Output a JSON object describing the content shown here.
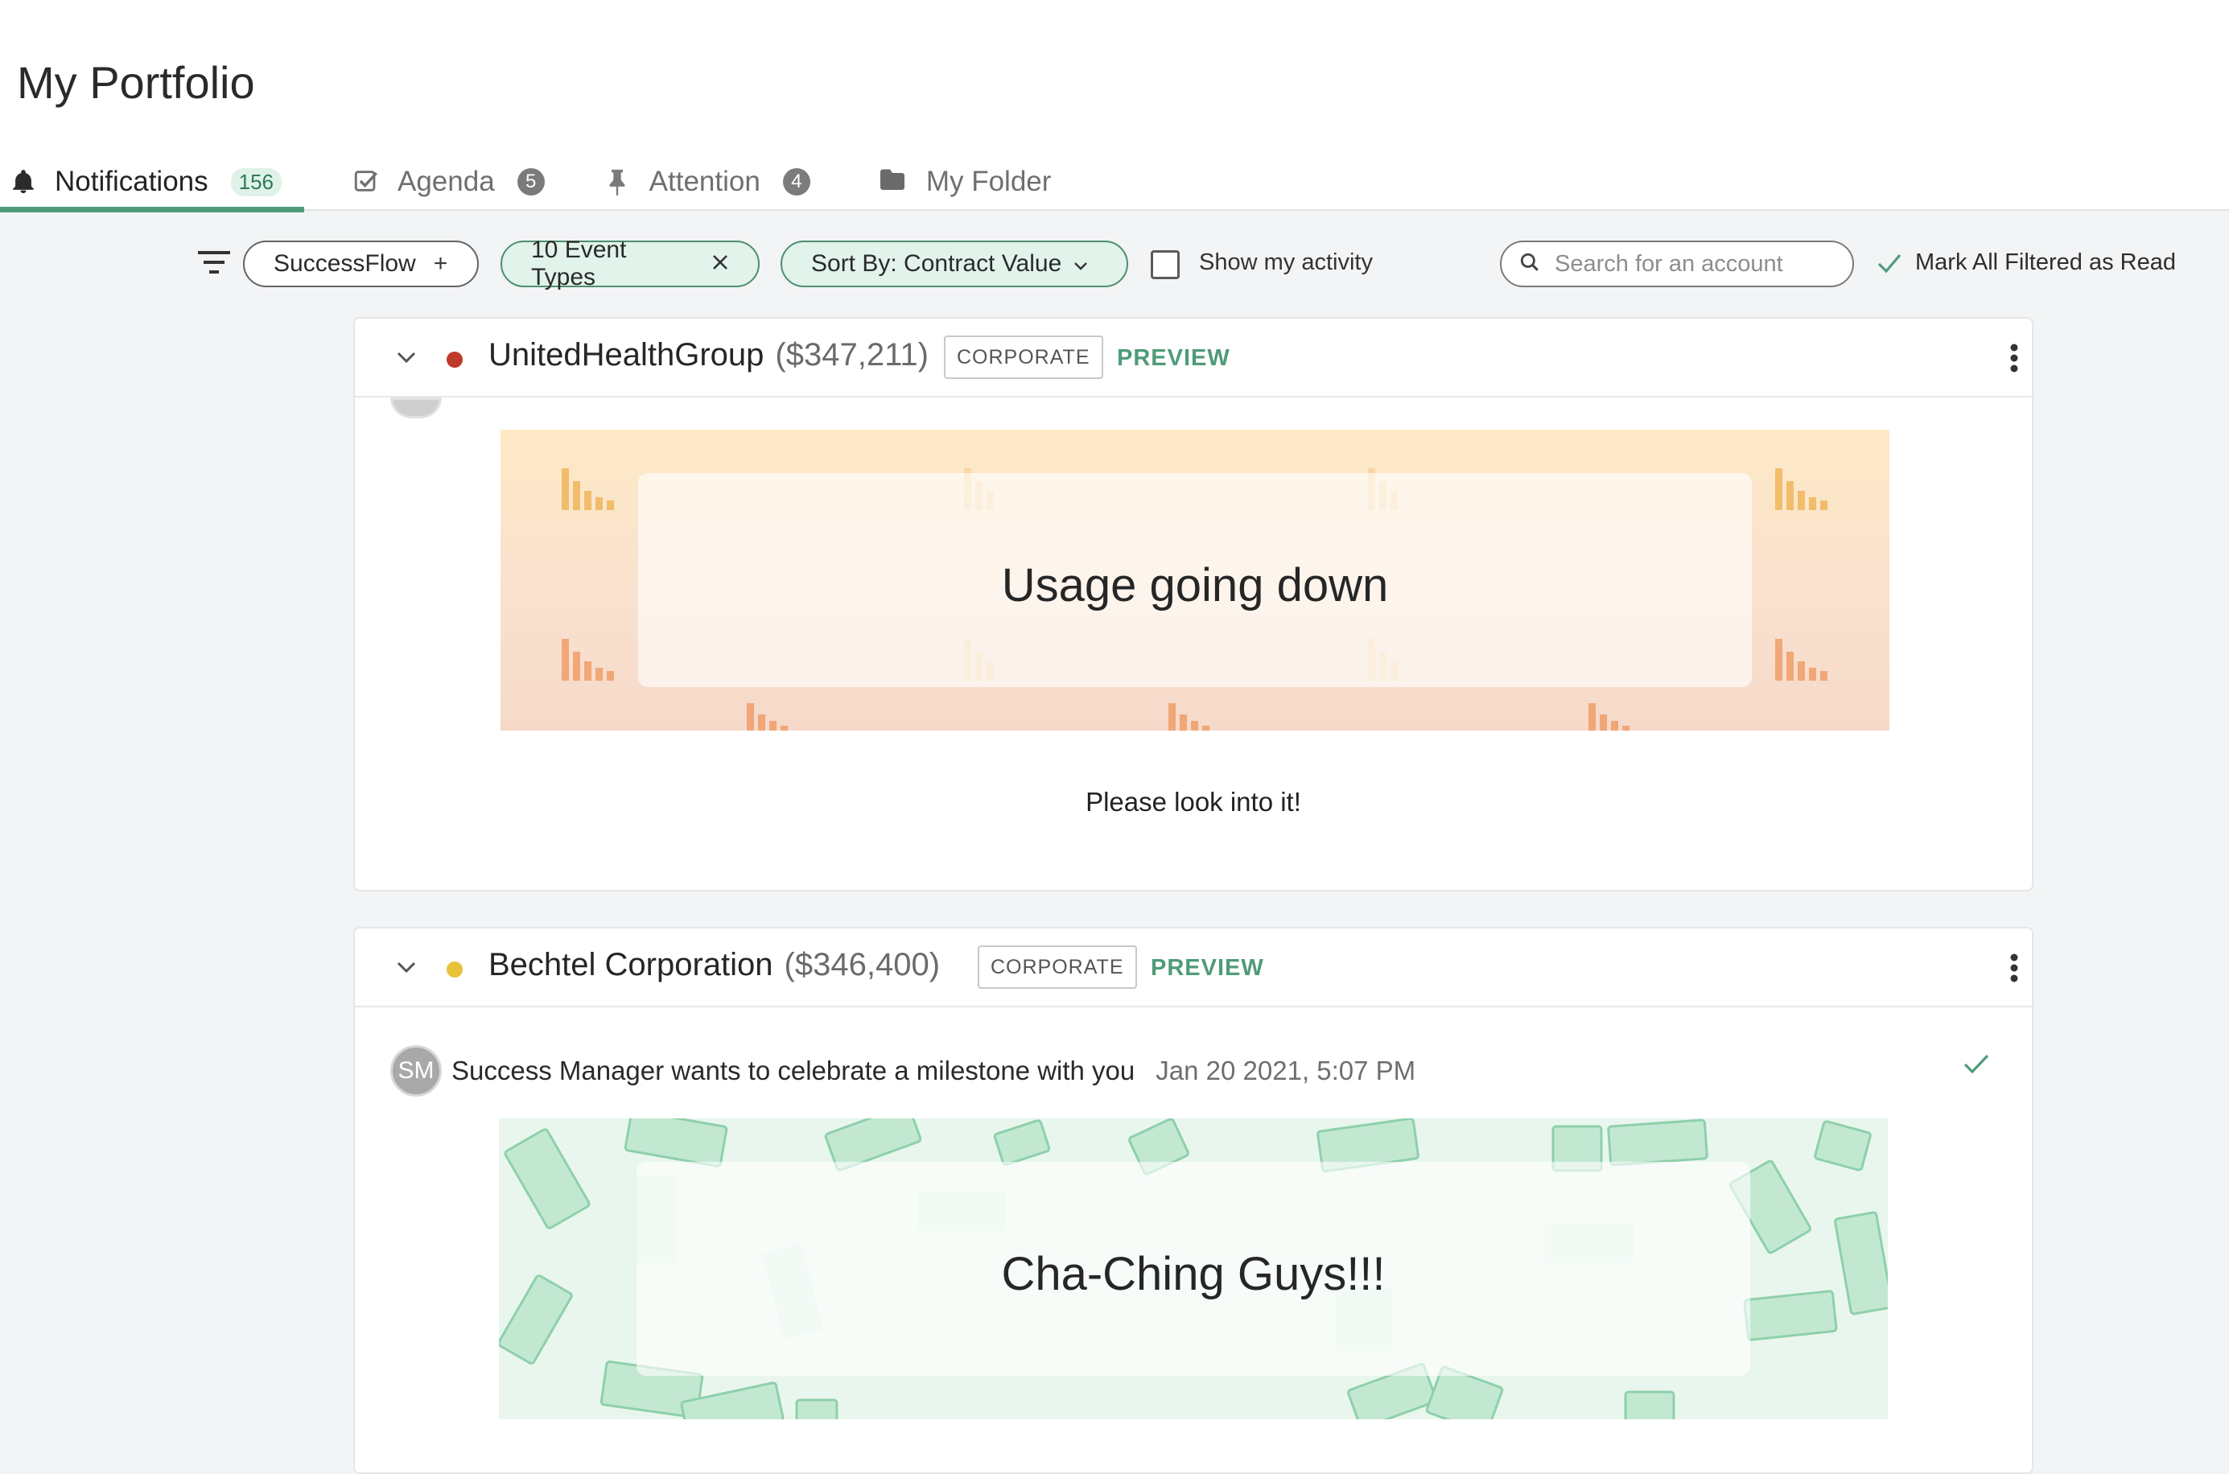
{
  "page": {
    "title": "My Portfolio"
  },
  "tabs": [
    {
      "label": "Notifications",
      "badge": "156",
      "icon": "bell-icon"
    },
    {
      "label": "Agenda",
      "badge": "5",
      "icon": "checkbox-icon"
    },
    {
      "label": "Attention",
      "badge": "4",
      "icon": "pin-icon"
    },
    {
      "label": "My Folder",
      "icon": "folder-icon"
    }
  ],
  "filters": {
    "successflow_label": "SuccessFlow",
    "event_types_label": "10 Event Types",
    "sort_label": "Sort By: Contract Value",
    "show_activity_label": "Show my activity",
    "search_placeholder": "Search for an account",
    "mark_read_label": "Mark All Filtered as Read"
  },
  "cards": [
    {
      "account": "UnitedHealthGroup",
      "value": "($347,211)",
      "status_color": "#c0392b",
      "badge": "CORPORATE",
      "preview": "PREVIEW",
      "banner_text": "Usage going down",
      "message": "Please look into it!"
    },
    {
      "account": "Bechtel Corporation",
      "value": "($346,400)",
      "status_color": "#e8c33a",
      "badge": "CORPORATE",
      "preview": "PREVIEW",
      "avatar_initials": "SM",
      "notification": "Success Manager wants to celebrate a milestone with you",
      "date": "Jan 20 2021, 5:07 PM",
      "banner_text": "Cha-Ching Guys!!!"
    }
  ],
  "colors": {
    "accent": "#4f9b79"
  }
}
